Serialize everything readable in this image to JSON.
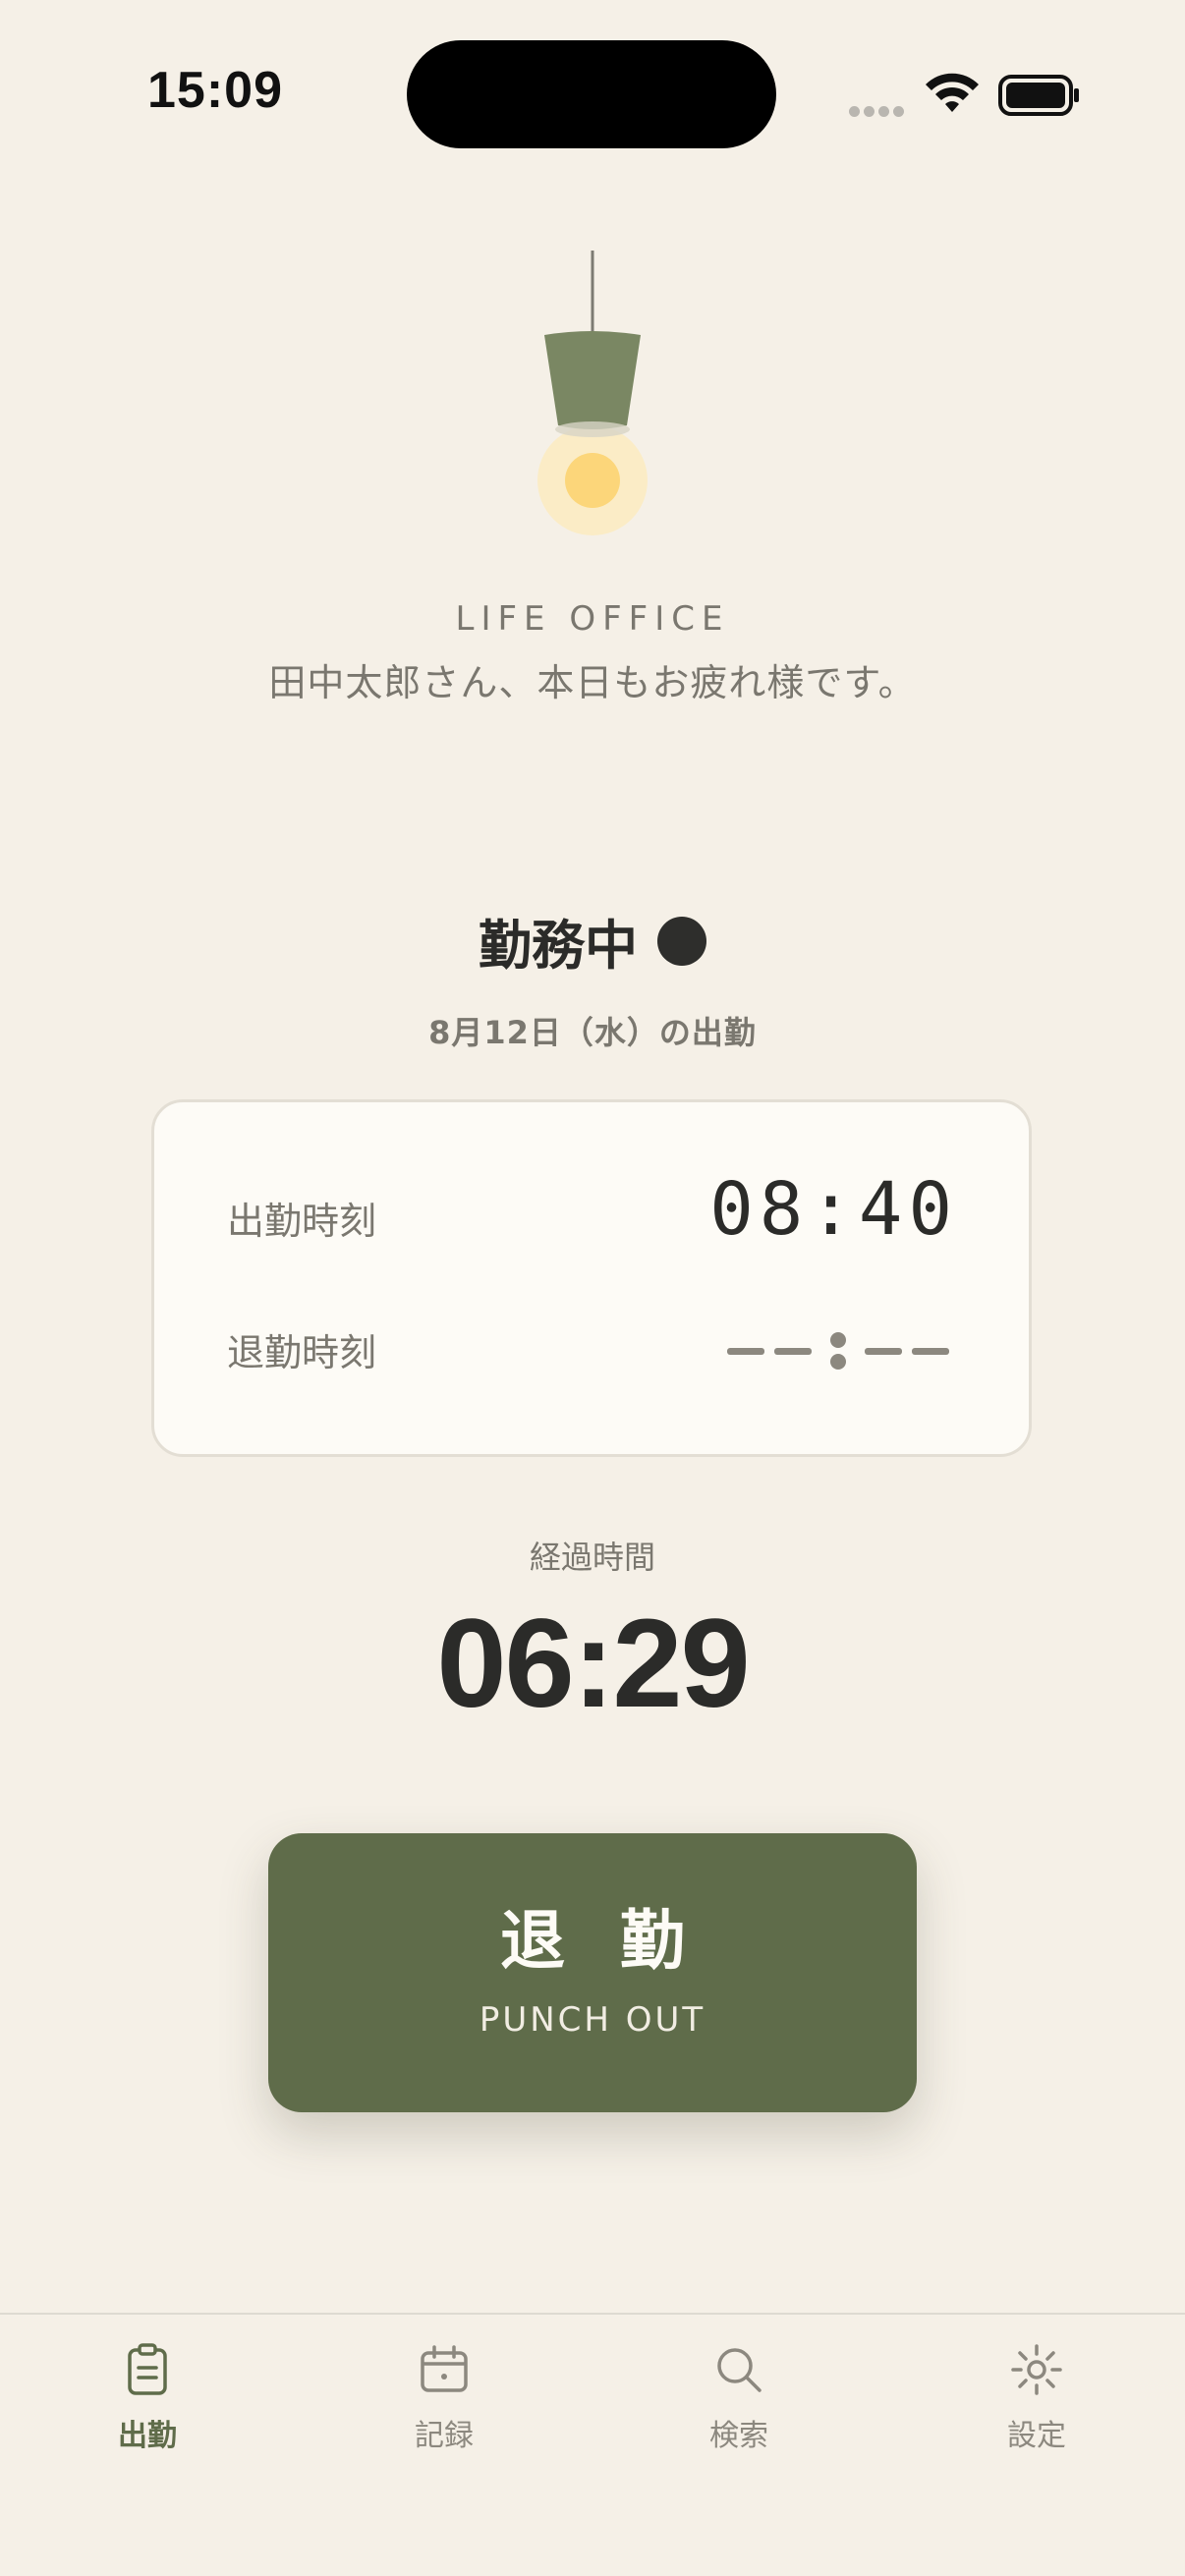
{
  "status_bar": {
    "time": "15:09"
  },
  "header": {
    "brand": "LIFE OFFICE",
    "greeting": "田中太郎さん、本日もお疲れ様です。"
  },
  "attendance": {
    "status": "勤務中",
    "date_line": "8月12日（水）の出勤",
    "clock_in_label": "出勤時刻",
    "clock_in_value": "08:40",
    "clock_out_label": "退勤時刻",
    "elapsed_label": "経過時間",
    "elapsed_value": "06:29"
  },
  "punch_button": {
    "label": "退勤",
    "sublabel": "PUNCH OUT"
  },
  "tabbar": {
    "items": [
      {
        "label": "出勤",
        "icon": "clipboard-icon",
        "active": true
      },
      {
        "label": "記録",
        "icon": "calendar-icon",
        "active": false
      },
      {
        "label": "検索",
        "icon": "search-icon",
        "active": false
      },
      {
        "label": "設定",
        "icon": "gear-icon",
        "active": false
      }
    ]
  },
  "colors": {
    "background": "#f5f0e7",
    "accent": "#5f6c4a",
    "card": "#fdfbf6",
    "muted_text": "#7a776f",
    "dark_text": "#2b2b29"
  }
}
